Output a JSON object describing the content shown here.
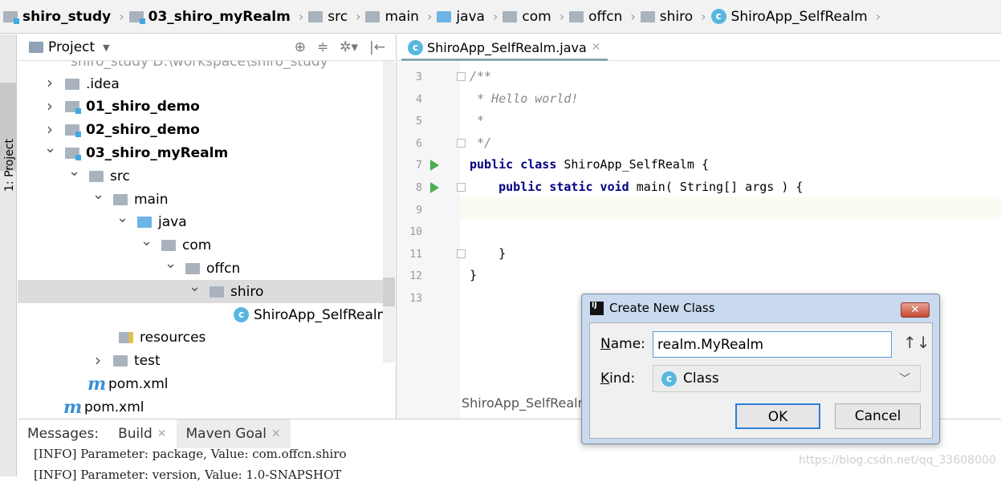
{
  "breadcrumb": [
    {
      "label": "shiro_study",
      "bold": true,
      "icon": "module-folder-icon"
    },
    {
      "label": "03_shiro_myRealm",
      "bold": true,
      "icon": "module-folder-icon"
    },
    {
      "label": "src",
      "icon": "folder-icon"
    },
    {
      "label": "main",
      "icon": "folder-icon"
    },
    {
      "label": "java",
      "icon": "source-folder-icon"
    },
    {
      "label": "com",
      "icon": "package-icon"
    },
    {
      "label": "offcn",
      "icon": "package-icon"
    },
    {
      "label": "shiro",
      "icon": "package-icon"
    },
    {
      "label": "ShiroApp_SelfRealm",
      "icon": "java-class-icon"
    }
  ],
  "side_stripe": {
    "label": "1: Project"
  },
  "project_panel": {
    "title": "Project",
    "root_partial": "shiro_study  D:\\workspace\\shiro_study",
    "tree": [
      {
        "label": ".idea",
        "level": 1,
        "arrow": ">",
        "icon": "folder"
      },
      {
        "label": "01_shiro_demo",
        "level": 1,
        "arrow": ">",
        "icon": "module",
        "bold": true
      },
      {
        "label": "02_shiro_demo",
        "level": 1,
        "arrow": ">",
        "icon": "module",
        "bold": true
      },
      {
        "label": "03_shiro_myRealm",
        "level": 1,
        "arrow": "v",
        "icon": "module",
        "bold": true
      },
      {
        "label": "src",
        "level": 2,
        "arrow": "v",
        "icon": "folder"
      },
      {
        "label": "main",
        "level": 3,
        "arrow": "v",
        "icon": "folder"
      },
      {
        "label": "java",
        "level": 4,
        "arrow": "v",
        "icon": "source"
      },
      {
        "label": "com",
        "level": 5,
        "arrow": "v",
        "icon": "package"
      },
      {
        "label": "offcn",
        "level": 6,
        "arrow": "v",
        "icon": "package"
      },
      {
        "label": "shiro",
        "level": 7,
        "arrow": "v",
        "icon": "package",
        "selected": true
      },
      {
        "label": "ShiroApp_SelfRealm",
        "level": 8,
        "arrow": "",
        "icon": "class"
      },
      {
        "label": "resources",
        "level": 3,
        "arrow": "",
        "icon": "resources"
      },
      {
        "label": "test",
        "level": 3,
        "arrow": ">",
        "icon": "folder"
      },
      {
        "label": "pom.xml",
        "level": 2,
        "arrow": "",
        "icon": "maven"
      },
      {
        "label": "pom.xml",
        "level": 1,
        "arrow": "",
        "icon": "maven"
      }
    ]
  },
  "editor": {
    "tab": "ShiroApp_SelfRealm.java",
    "lines": [
      {
        "n": "3",
        "text": "/**",
        "cls": "cm"
      },
      {
        "n": "4",
        "text": " * Hello world!",
        "cls": "cm"
      },
      {
        "n": "5",
        "text": " *",
        "cls": "cm"
      },
      {
        "n": "6",
        "text": " */",
        "cls": "cm"
      },
      {
        "n": "7",
        "kw": "public class ",
        "text": "ShiroApp_SelfRealm {",
        "run": true
      },
      {
        "n": "8",
        "kw": "    public static void ",
        "text": "main( String[] args ) {",
        "run": true
      },
      {
        "n": "9",
        "text": ""
      },
      {
        "n": "10",
        "text": ""
      },
      {
        "n": "11",
        "text": "    }"
      },
      {
        "n": "12",
        "text": "}"
      },
      {
        "n": "13",
        "text": ""
      }
    ],
    "breadcrumb_footer": "ShiroApp_SelfRealm"
  },
  "bottom": {
    "label": "Messages:",
    "tabs": [
      "Build",
      "Maven Goal"
    ],
    "log": [
      "[INFO] Parameter: package, Value: com.offcn.shiro",
      "[INFO] Parameter: version, Value: 1.0-SNAPSHOT"
    ]
  },
  "watermark": "https://blog.csdn.net/qq_33608000",
  "dialog": {
    "title": "Create New Class",
    "name_label_u": "N",
    "name_label": "ame:",
    "name_value": "realm.MyRealm",
    "kind_label_u": "K",
    "kind_label": "ind:",
    "kind_value": "Class",
    "ok": "OK",
    "cancel": "Cancel"
  }
}
